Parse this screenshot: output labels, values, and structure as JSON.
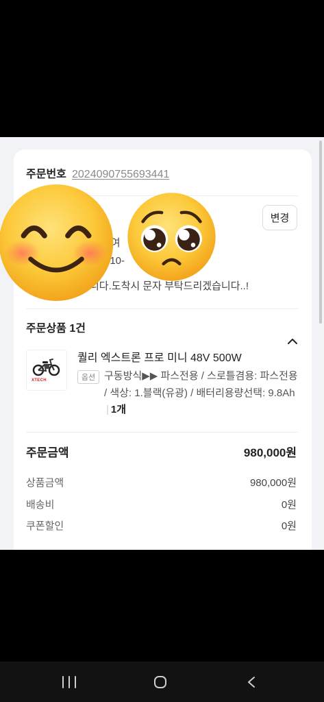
{
  "order": {
    "number_label": "주문번호",
    "number": "2024090755693441"
  },
  "delivery": {
    "change_button": "변경",
    "line1_fragment": "펴여",
    "line2_fragment": "010-",
    "message_fragment": "니다.도착시 문자 부탁드리겠습니다..!"
  },
  "products": {
    "header": "주문상품 1건",
    "items": [
      {
        "name": "퀄리 엑스트론 프로 미니 48V 500W",
        "option_badge": "옵션",
        "option_text": "구동방식▶▶ 파스전용 / 스로틀겸용: 파스전용 / 색상: 1.블랙(유광) / 배터리용량선택: 9.8Ah",
        "quantity_separator": "|",
        "quantity": "1개",
        "thumbnail_logo": "XTECH"
      }
    ]
  },
  "payment": {
    "total_label": "주문금액",
    "total_value": "980,000원",
    "rows": [
      {
        "label": "상품금액",
        "value": "980,000원"
      },
      {
        "label": "배송비",
        "value": "0원"
      },
      {
        "label": "쿠폰할인",
        "value": "0원"
      }
    ]
  },
  "overlays": [
    "smiling-face-with-smiling-eyes-emoji",
    "pleading-face-emoji"
  ],
  "icons": {
    "collapse": "chevron-up-icon",
    "nav_recent": "recent-apps-icon",
    "nav_home": "home-icon",
    "nav_back": "back-icon"
  },
  "colors": {
    "page_background": "#f2f3f6",
    "card": "#ffffff",
    "text_primary": "#222222",
    "text_secondary": "#666666",
    "link": "#8a8a8a",
    "emoji_yellow": "#fbbf24",
    "navbar": "#121212"
  }
}
